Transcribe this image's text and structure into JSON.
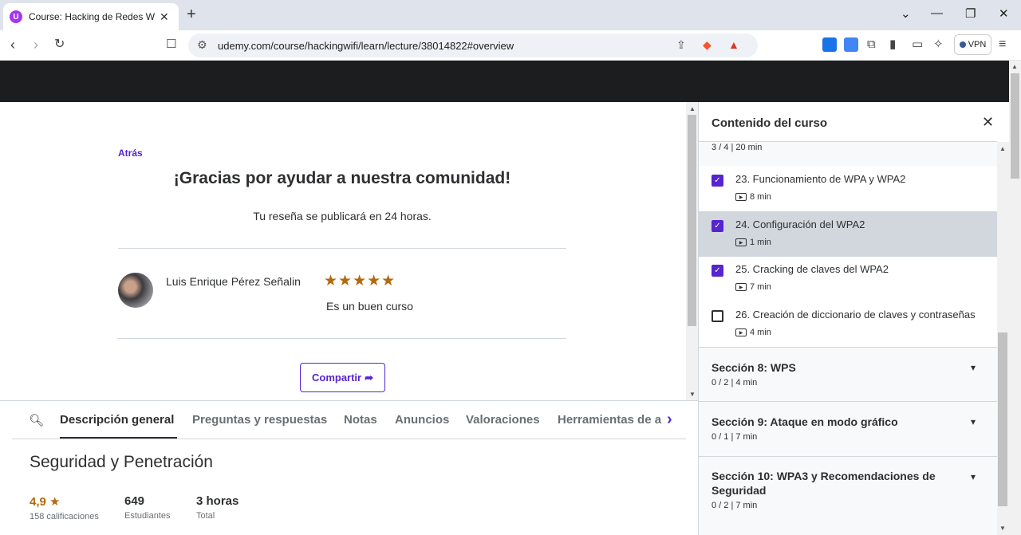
{
  "browser": {
    "tab_title": "Course: Hacking de Redes Wi-F",
    "tab_favicon": "U",
    "new_tab": "+",
    "url": "udemy.com/course/hackingwifi/learn/lecture/38014822#overview",
    "vpn_label": "VPN"
  },
  "review": {
    "back": "Atrás",
    "thanks": "¡Gracias por ayudar a nuestra comunidad!",
    "note": "Tu reseña se publicará en 24 horas.",
    "reviewer": "Luis Enrique Pérez Señalin",
    "rating": 5,
    "stars": "★★★★★",
    "text": "Es un buen curso",
    "share": "Compartir"
  },
  "tabs": [
    {
      "label": "Descripción general"
    },
    {
      "label": "Preguntas y respuestas"
    },
    {
      "label": "Notas"
    },
    {
      "label": "Anuncios"
    },
    {
      "label": "Valoraciones"
    },
    {
      "label": "Herramientas de a"
    }
  ],
  "course": {
    "title": "Seguridad y Penetración",
    "rating_value": "4,9",
    "rating_label": "158 calificaciones",
    "students_value": "649",
    "students_label": "Estudiantes",
    "hours_value": "3 horas",
    "hours_label": "Total"
  },
  "sidebar": {
    "title": "Contenido del curso",
    "current_section_meta": "3 / 4 | 20 min",
    "lectures": [
      {
        "title": "23. Funcionamiento de WPA y WPA2",
        "duration": "8 min",
        "checked": true,
        "active": false
      },
      {
        "title": "24. Configuración del WPA2",
        "duration": "1 min",
        "checked": true,
        "active": true
      },
      {
        "title": "25. Cracking de claves del WPA2",
        "duration": "7 min",
        "checked": true,
        "active": false
      },
      {
        "title": "26. Creación de diccionario de claves y contraseñas",
        "duration": "4 min",
        "checked": false,
        "active": false
      }
    ],
    "sections": [
      {
        "title": "Sección 8: WPS",
        "meta": "0 / 2 | 4 min"
      },
      {
        "title": "Sección 9: Ataque en modo gráfico",
        "meta": "0 / 1 | 7 min"
      },
      {
        "title": "Sección 10: WPA3 y Recomendaciones de Seguridad",
        "meta": "0 / 2 | 7 min"
      }
    ]
  },
  "colors": {
    "accent": "#5624d0",
    "star": "#b4690e",
    "header_dark": "#1c1d1f"
  }
}
